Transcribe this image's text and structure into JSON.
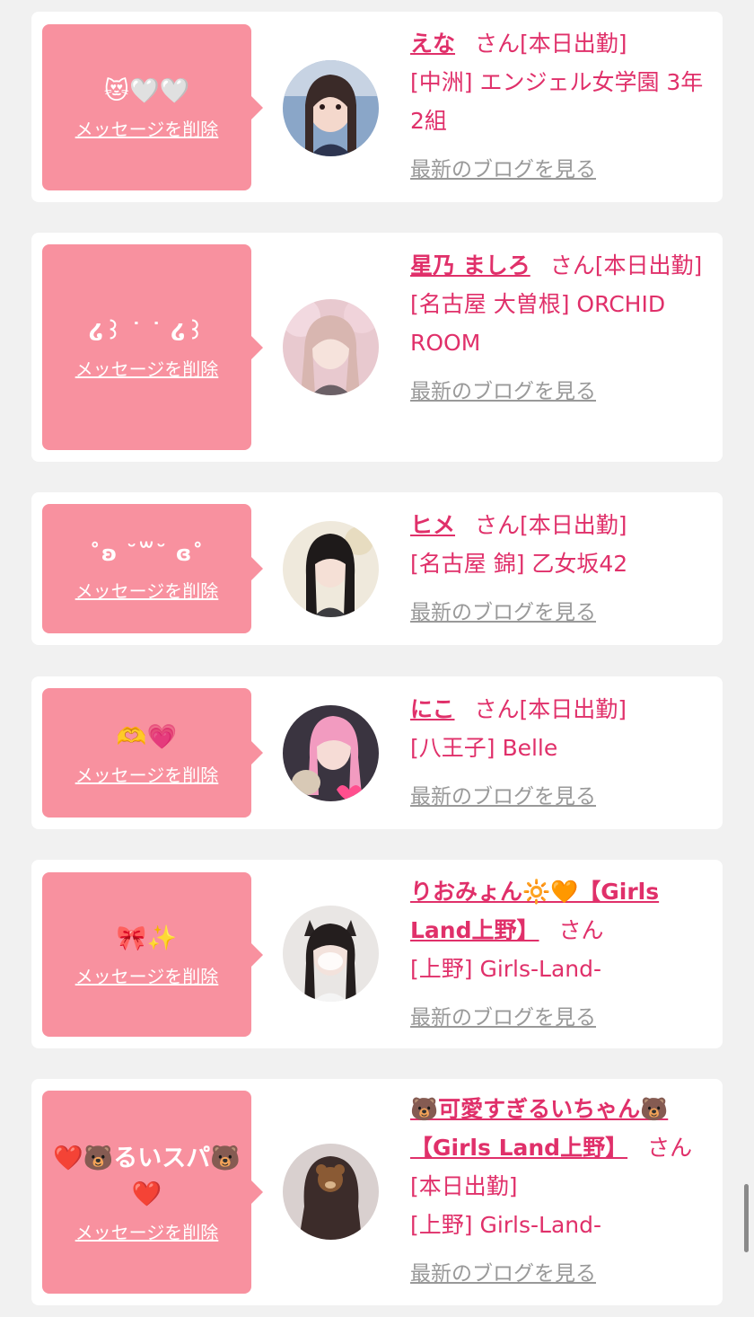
{
  "ui": {
    "delete_label": "メッセージを削除",
    "blog_label": "最新のブログを見る",
    "san": "さん",
    "status": "[本日出勤]"
  },
  "messages": [
    {
      "message": "😻🤍🤍",
      "name": "えな",
      "location": "[中洲] エンジェル女学園 3年2組",
      "avatar_icon": "girl-portrait"
    },
    {
      "message": "໒꒱ ˙ ˙ ໒꒱",
      "name": "星乃 ましろ",
      "location": "[名古屋 大曽根] ORCHID ROOM",
      "avatar_icon": "girl-portrait"
    },
    {
      "message": "˚ʚ ˘꒳˘ ɞ˚",
      "name": "ヒメ",
      "location": "[名古屋 錦] 乙女坂42",
      "avatar_icon": "girl-portrait"
    },
    {
      "message": "🫶💗",
      "name": "にこ",
      "location": "[八王子] Belle",
      "avatar_icon": "girl-portrait"
    },
    {
      "message": "🎀✨",
      "name": "りおみょん🔆🧡【Girls Land上野】",
      "location": "[上野] Girls-Land-",
      "avatar_icon": "girl-portrait"
    },
    {
      "message": "❤️🐻るいスパ🐻❤️",
      "name": "🐻可愛すぎるいちゃん🐻【Girls Land上野】",
      "location": "[上野] Girls-Land-",
      "avatar_icon": "girl-portrait"
    }
  ],
  "colors": {
    "bubble": "#f8919f",
    "accent": "#e0306a",
    "link_gray": "#999999",
    "background": "#f1f1f1"
  }
}
